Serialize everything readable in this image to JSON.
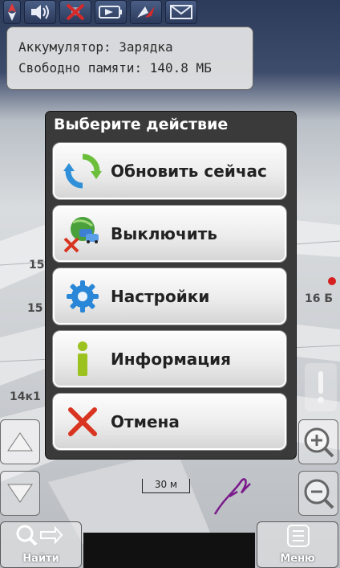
{
  "status_bar": {
    "icons": [
      "compass-icon",
      "speaker-icon",
      "satellite-off-icon",
      "battery-icon",
      "navigation-arrow-icon",
      "message-icon"
    ]
  },
  "info_box": {
    "battery_line": "Аккумулятор: Зарядка",
    "memory_line": "Свободно памяти: 140.8 МБ"
  },
  "dialog": {
    "title": "Выберите действие",
    "actions": [
      {
        "label": "Обновить сейчас",
        "icon": "refresh-icon"
      },
      {
        "label": "Выключить",
        "icon": "traffic-off-icon"
      },
      {
        "label": "Настройки",
        "icon": "gear-icon"
      },
      {
        "label": "Информация",
        "icon": "info-icon"
      },
      {
        "label": "Отмена",
        "icon": "cancel-icon"
      }
    ]
  },
  "map": {
    "labels": [
      "15",
      "15",
      "16 Б",
      "14к1"
    ],
    "scale_label": "30 м"
  },
  "bottom_bar": {
    "find_label": "Найти",
    "menu_label": "Меню"
  },
  "colors": {
    "dialog_bg": "#3a3a3a",
    "button_face": "#ececec",
    "refresh_green": "#6cbf3a",
    "refresh_blue": "#2f8fd8",
    "gear_blue": "#2a86d6",
    "info_green": "#9bc21e",
    "cancel_red": "#d8341f"
  }
}
